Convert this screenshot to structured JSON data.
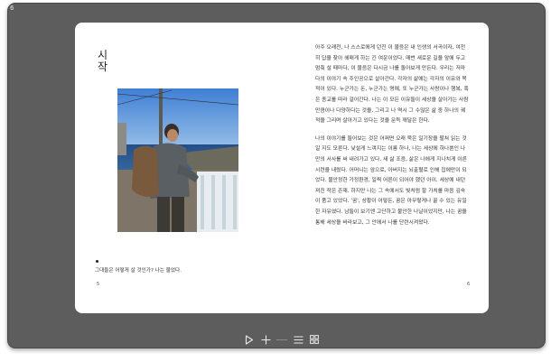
{
  "window": {
    "corner_label": "6"
  },
  "left_page": {
    "title": "시작",
    "caption": "그대들은 어떻게 살 것인가? 나는 물었다.",
    "page_number": "5"
  },
  "right_page": {
    "paragraphs": [
      "아주 오래전, 나 스스로에게 던진 이 물음은 내 인생의 서곡이자, 여전히 답을 찾아 헤매게 하는 긴 여운이었다. 매번 새로운 길을 앞에 두고 멈춰 설 때마다, 이 물음은 다시금 나를 돌아보게 만든다. 우리는 저마다의 이야기 속 주인공으로 살아간다. 각자의 삶에는 각자의 이유와 목적이 있다. 누군가는 돈, 누군가는 명예, 또 누군가는 사랑이나 행복, 혹은 종교를 따라 걸어간다. 나는 이 모든 이유들이 세상을 살아가는 사람만큼이나 다양하다는 것을, 그리고 나 역시 그 수많은 삶 중 하나의 궤적을 그리며 살아가고 있다는 것을 문득 깨달은 한다.",
      "나의 이야기를 들어보는 것은 어쩌면 오래 묵은 일기장을 펼쳐 읽는 것일 지도 모른다. 낯설게 느껴지는 이름 하나, 나는 세상에 하나뿐인 나만의 서사를 써 내려가고 있다. 새 삶 조음, 삶은 나에게 지나치게 이른 시련을 내렸다. 어머니는 암으로, 아버지는 뇌출혈로 인해 집에만이 되었다. 불안정한 가정환경, 일찍 어른이 되어야 했던 아이. 세상에 내던져진 작은 존재. 하지만 나는 그 속에서도 빛처럼 할 가치를 마음 깊숙이 품고 있었다. '꿈', 상황이 어떻든, 꿈은 아무렇게나 꿀 수 있는 유일한 자유였다. 남들이 보기엔 고단하고 불안한 나날이었지만, 나는 꿈을 통해 세상을 바라보고, 그 안에서 나를 단련시켜왔다."
    ],
    "page_number": "6"
  },
  "toolbar": [
    {
      "name": "play-icon"
    },
    {
      "name": "plus-icon"
    },
    {
      "name": "list-icon"
    },
    {
      "name": "grid-icon"
    }
  ],
  "colors": {
    "window_bg": "#5d5d5d",
    "page_bg": "#ffffff",
    "text": "#333333"
  }
}
